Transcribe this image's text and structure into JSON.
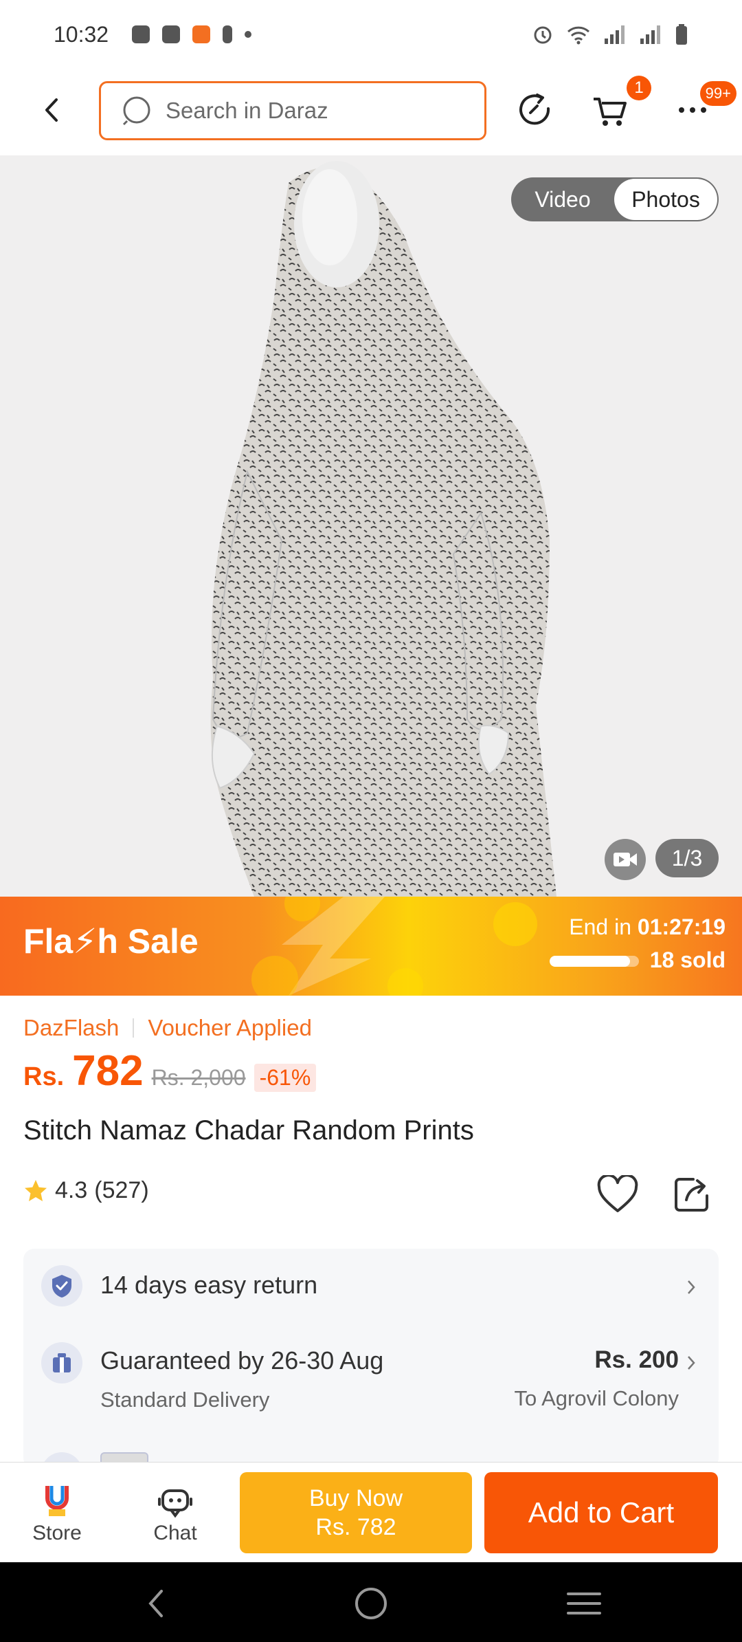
{
  "status_bar": {
    "time": "10:32"
  },
  "search": {
    "placeholder": "Search in Daraz"
  },
  "header": {
    "cart_badge": "1",
    "more_badge": "99+"
  },
  "gallery": {
    "toggle_video": "Video",
    "toggle_photos": "Photos",
    "counter": "1/3"
  },
  "flash_sale": {
    "title": "Fla⚡h  Sale",
    "end_label": "End in",
    "end_time": "01:27:19",
    "sold": "18 sold",
    "progress": 0.9
  },
  "product": {
    "tag_1": "DazFlash",
    "tag_2": "Voucher Applied",
    "currency": "Rs.",
    "price": "782",
    "old_price": "Rs. 2,000",
    "discount": "-61%",
    "title": "Stitch Namaz Chadar Random Prints",
    "rating": "4.3",
    "reviews": "(527)"
  },
  "services": {
    "return_text": "14 days easy return",
    "delivery_title": "Guaranteed by 26-30 Aug",
    "delivery_type": "Standard Delivery",
    "delivery_fee": "Rs. 200",
    "delivery_location": "To Agrovil Colony"
  },
  "bottom_bar": {
    "store_label": "Store",
    "chat_label": "Chat",
    "buy_now_label": "Buy Now",
    "buy_now_price": "Rs. 782",
    "add_to_cart_label": "Add to Cart"
  },
  "colors": {
    "brand_orange": "#f85606",
    "buy_now_yellow": "#fbb017"
  }
}
